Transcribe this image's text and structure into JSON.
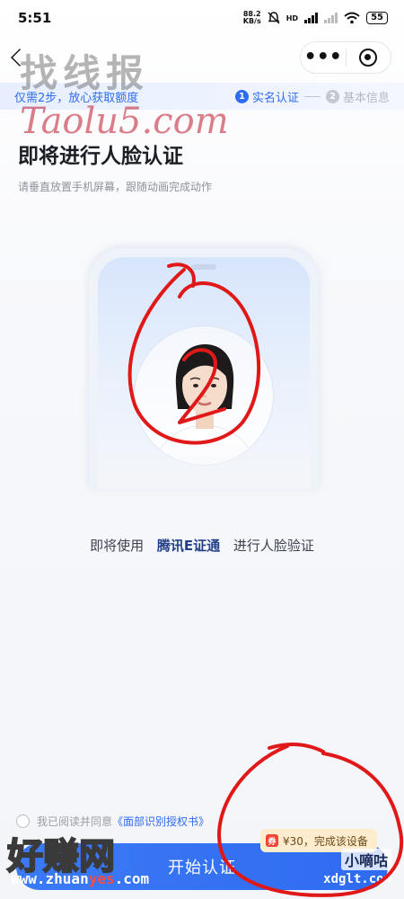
{
  "status": {
    "time": "5:51",
    "net_speed_value": "88.2",
    "net_speed_unit": "KB/s",
    "hd_label": "HD",
    "battery": "55"
  },
  "nav": {
    "more_label": "•••"
  },
  "watermark": {
    "top_line1": "找线报",
    "top_line2": "Taolu5.com",
    "bottom_left": "好赚网",
    "bottom_left_url_pre": "www.zhuan",
    "bottom_left_url_hl": "yes",
    "bottom_left_url_post": ".com",
    "bottom_right": "小嘀咕",
    "bottom_right_url": "xdglt.com"
  },
  "steps": {
    "tip": "仅需2步，放心获取额度",
    "items": [
      {
        "num": "1",
        "label": "实名认证"
      },
      {
        "num": "2",
        "label": "基本信息"
      }
    ]
  },
  "main": {
    "title": "即将进行人脸认证",
    "subtitle": "请垂直放置手机屏幕，跟随动画完成动作",
    "desc_pre": "即将使用",
    "desc_brand": "腾讯E证通",
    "desc_post": "进行人脸验证"
  },
  "agreement": {
    "prefix": "我已阅读并同意",
    "link": "《面部识别授权书》"
  },
  "start_button": "开始认证",
  "reward_tip": {
    "icon": "券",
    "text": "¥30，完成该设备"
  },
  "colors": {
    "primary": "#2f6bf0",
    "annotation_red": "#e01818"
  }
}
